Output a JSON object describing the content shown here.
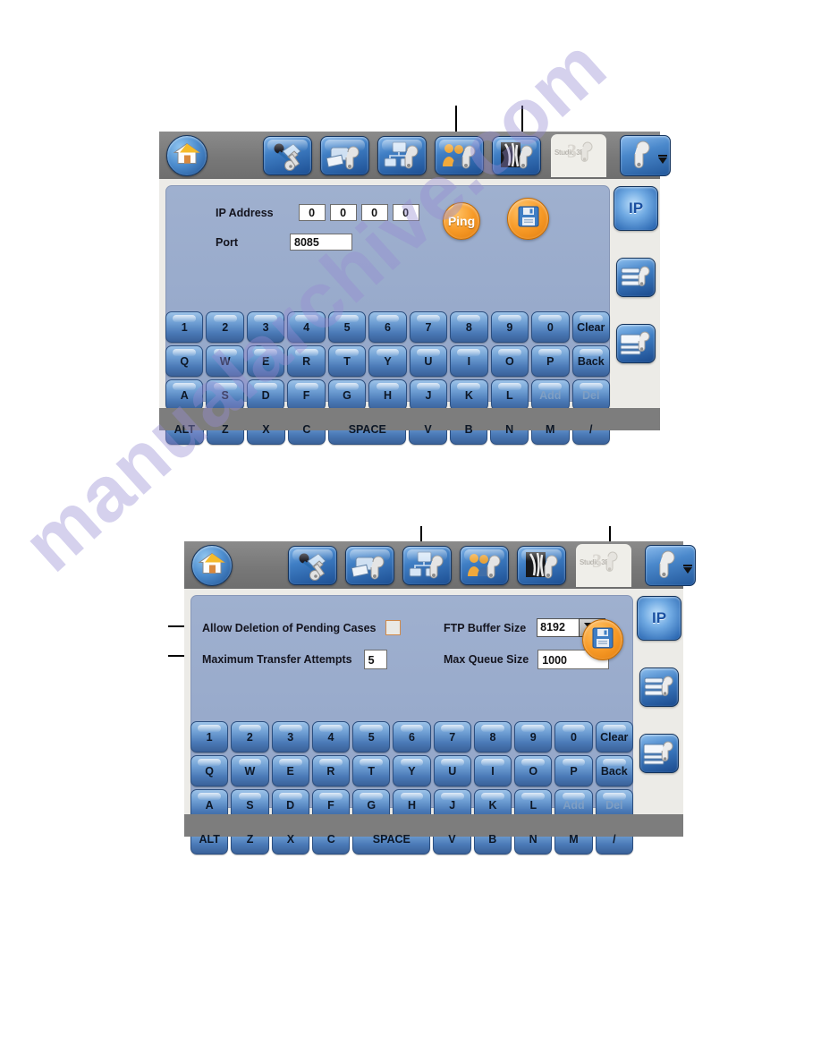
{
  "page": {
    "watermark": "manualarchive.com"
  },
  "toolbar": {
    "home_label": "Home",
    "tools": [
      {
        "name": "acquisition-settings",
        "label": "Acquisition Settings"
      },
      {
        "name": "printer-settings",
        "label": "Printer Settings"
      },
      {
        "name": "network-settings",
        "label": "Network Settings"
      },
      {
        "name": "user-settings",
        "label": "User Settings"
      },
      {
        "name": "image-settings",
        "label": "Image Settings"
      }
    ],
    "studio_tab_label": "Studio 3D",
    "more_label": "More Settings"
  },
  "rail": {
    "ip_label": "IP",
    "items": [
      {
        "name": "ip-settings",
        "label": "IP"
      },
      {
        "name": "list-settings",
        "label": "List Settings"
      },
      {
        "name": "record-settings",
        "label": "Record Settings"
      }
    ]
  },
  "panel1": {
    "ip_address_label": "IP Address",
    "ip_octets": [
      "0",
      "0",
      "0",
      "0"
    ],
    "port_label": "Port",
    "port_value": "8085",
    "ping_label": "Ping",
    "save_label": "Save"
  },
  "panel2": {
    "allow_deletion_label": "Allow Deletion of Pending Cases",
    "allow_deletion_checked": false,
    "max_transfer_label": "Maximum Transfer Attempts",
    "max_transfer_value": "5",
    "ftp_buffer_label": "FTP Buffer Size",
    "ftp_buffer_value": "8192",
    "max_queue_label": "Max Queue Size",
    "max_queue_value": "1000",
    "save_label": "Save"
  },
  "keyboard": {
    "row1": [
      "1",
      "2",
      "3",
      "4",
      "5",
      "6",
      "7",
      "8",
      "9",
      "0",
      "Clear"
    ],
    "row2": [
      "Q",
      "W",
      "E",
      "R",
      "T",
      "Y",
      "U",
      "I",
      "O",
      "P",
      "Back"
    ],
    "row3": [
      "A",
      "S",
      "D",
      "F",
      "G",
      "H",
      "J",
      "K",
      "L",
      "Add",
      "Del"
    ],
    "row4": [
      "ALT",
      "Z",
      "X",
      "C",
      "SPACE",
      "V",
      "B",
      "N",
      "M",
      "/"
    ],
    "disabled_keys": [
      "Add",
      "Del"
    ]
  },
  "colors": {
    "accent_orange": "#f79a27",
    "panel_blue": "#97a9ca",
    "chrome_gray": "#7d7d7d",
    "key_blue": "#6f9fd4",
    "ip_blue": "#1a4fa0"
  }
}
